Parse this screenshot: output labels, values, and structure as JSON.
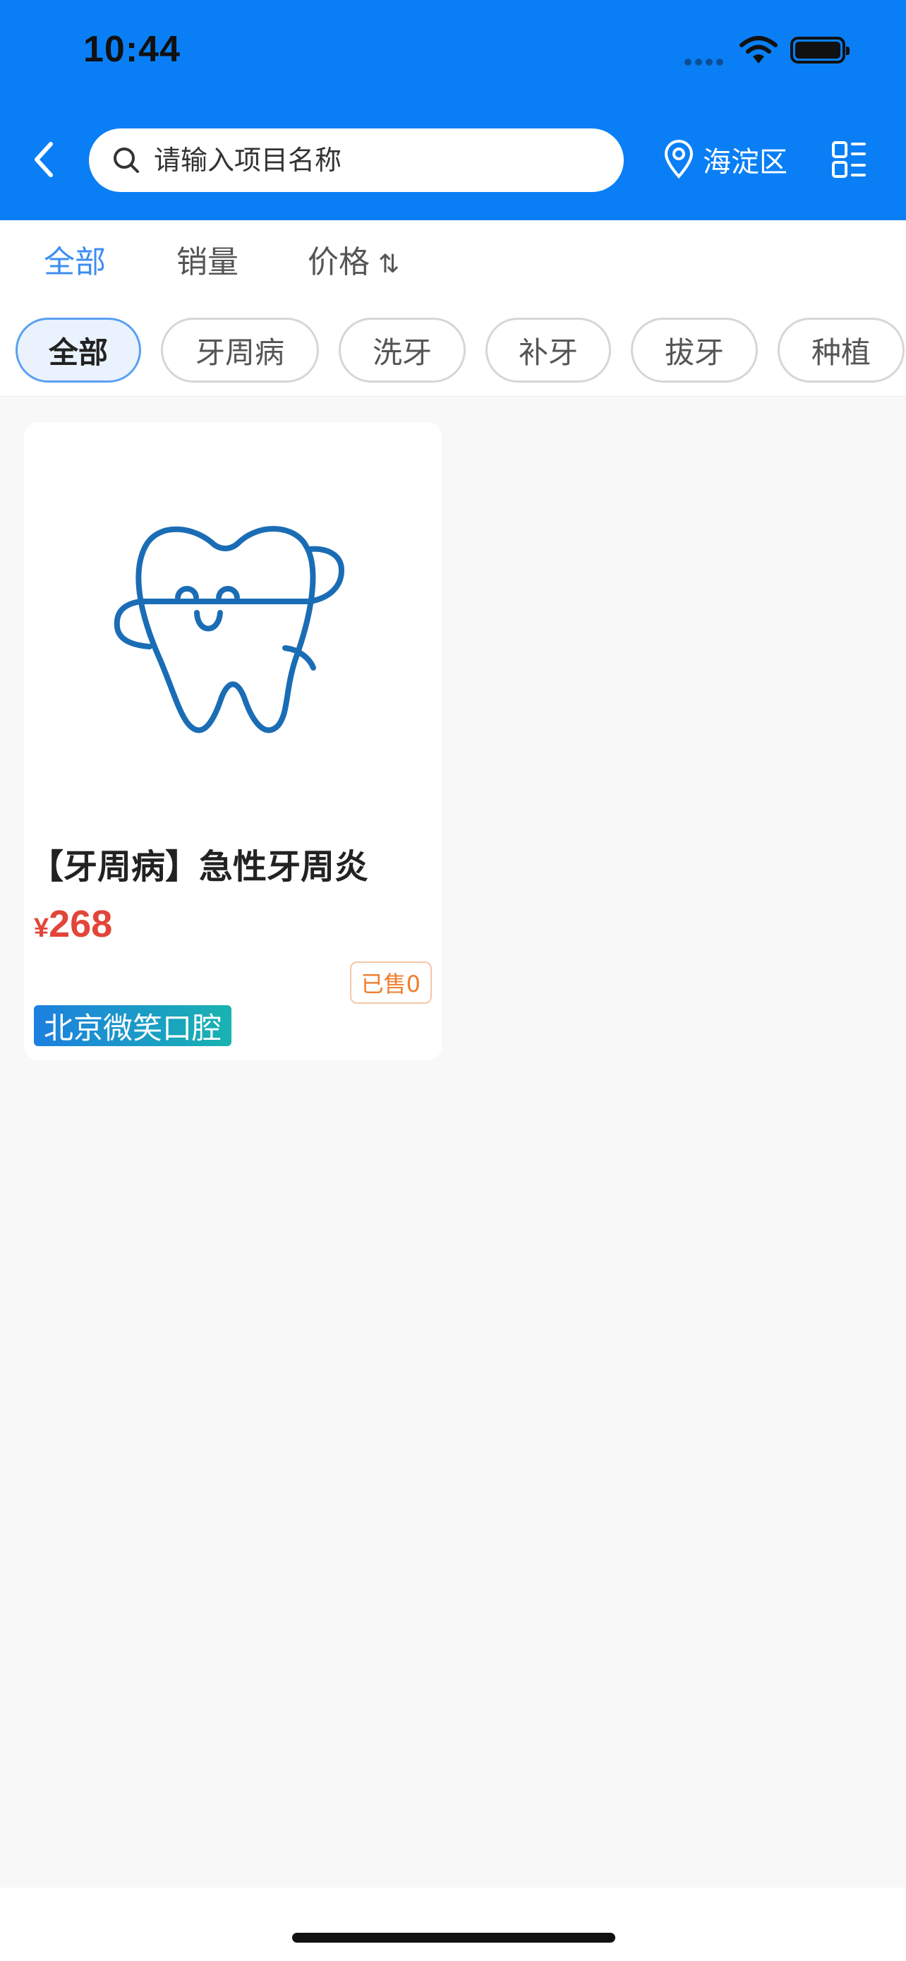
{
  "status_bar": {
    "time": "10:44"
  },
  "header": {
    "search_placeholder": "请输入项目名称",
    "location": "海淀区",
    "colors": {
      "background": "#0a7ff5"
    }
  },
  "sort_tabs": [
    {
      "label": "全部",
      "active": true
    },
    {
      "label": "销量",
      "active": false
    },
    {
      "label": "价格",
      "active": false
    }
  ],
  "categories": [
    {
      "label": "全部",
      "active": true
    },
    {
      "label": "牙周病",
      "active": false
    },
    {
      "label": "洗牙",
      "active": false
    },
    {
      "label": "补牙",
      "active": false
    },
    {
      "label": "拔牙",
      "active": false
    },
    {
      "label": "种植",
      "active": false
    }
  ],
  "products": [
    {
      "image_icon": "tooth-floss-icon",
      "title": "【牙周病】急性牙周炎",
      "price_currency": "¥",
      "price": "268",
      "sold": "已售0",
      "clinic": "北京微笑口腔"
    }
  ],
  "colors": {
    "accent": "#3d8ef2",
    "price": "#e2453a",
    "sold_badge": "#f07d2c"
  }
}
